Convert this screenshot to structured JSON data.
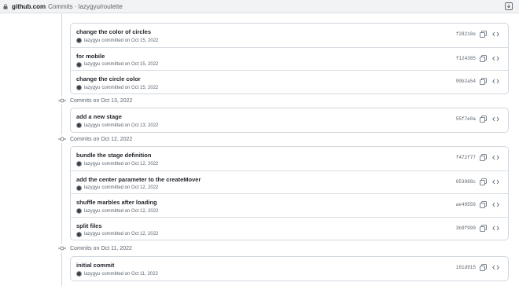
{
  "browser": {
    "domain": "github.com",
    "title": "Commits · lazygyu/roulette"
  },
  "groups": [
    {
      "heading": "",
      "commits": [
        {
          "message": "change the color of circles",
          "author": "lazygyu",
          "committed": "committed on Oct 15, 2022",
          "sha": "f28210e"
        },
        {
          "message": "for mobile",
          "author": "lazygyu",
          "committed": "committed on Oct 15, 2022",
          "sha": "f124305"
        },
        {
          "message": "change the circle color",
          "author": "lazygyu",
          "committed": "committed on Oct 15, 2022",
          "sha": "90b2a54"
        }
      ]
    },
    {
      "heading": "Commits on Oct 13, 2022",
      "commits": [
        {
          "message": "add a new stage",
          "author": "lazygyu",
          "committed": "committed on Oct 13, 2022",
          "sha": "55f7e0a"
        }
      ]
    },
    {
      "heading": "Commits on Oct 12, 2022",
      "commits": [
        {
          "message": "bundle the stage definition",
          "author": "lazygyu",
          "committed": "committed on Oct 12, 2022",
          "sha": "f472f77"
        },
        {
          "message": "add the center parameter to the createMover",
          "author": "lazygyu",
          "committed": "committed on Oct 12, 2022",
          "sha": "053988c"
        },
        {
          "message": "shuffle marbles after loading",
          "author": "lazygyu",
          "committed": "committed on Oct 12, 2022",
          "sha": "ae49556"
        },
        {
          "message": "split files",
          "author": "lazygyu",
          "committed": "committed on Oct 12, 2022",
          "sha": "3b9f999"
        }
      ]
    },
    {
      "heading": "Commits on Oct 11, 2022",
      "commits": [
        {
          "message": "initial commit",
          "author": "lazygyu",
          "committed": "committed on Oct 11, 2022",
          "sha": "161d915"
        }
      ]
    }
  ],
  "icons": {
    "lock": "lock-icon",
    "download": "download-icon",
    "commit": "commit-node-icon",
    "copy": "copy-icon",
    "browse": "code-icon"
  },
  "colors": {
    "text": "#1f2328",
    "muted": "#59636e",
    "border": "#d0d7de",
    "chrome": "#f1f3f4"
  }
}
